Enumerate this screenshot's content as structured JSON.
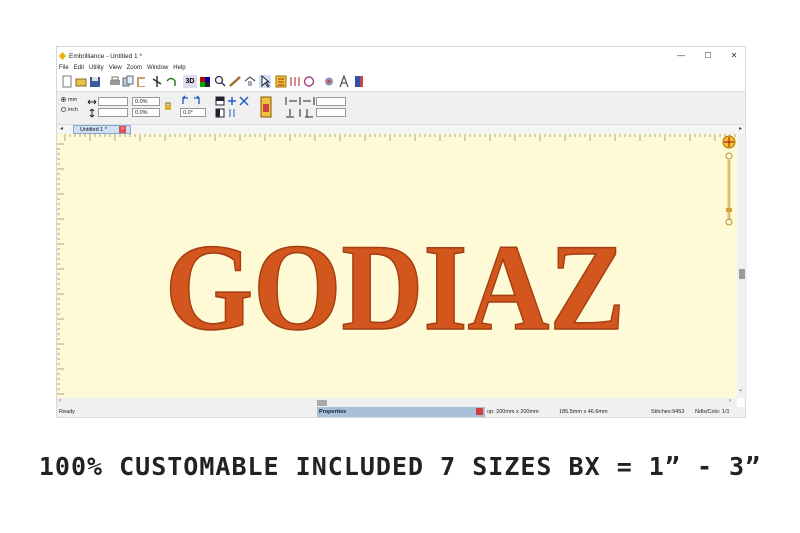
{
  "window": {
    "title": "Embrilliance - Untitled 1 *",
    "controls": {
      "minimize": "—",
      "maximize": "☐",
      "close": "✕"
    }
  },
  "menu": [
    "File",
    "Edit",
    "Utility",
    "View",
    "Zoom",
    "Window",
    "Help"
  ],
  "toolbar": {
    "icons": [
      "new-icon",
      "open-icon",
      "save-icon",
      "print-icon",
      "copy-icon",
      "paste-icon",
      "cut-icon",
      "undo-icon",
      "3d-icon",
      "color-icon",
      "zoom-icon",
      "measure-icon",
      "hoop-icon",
      "select-icon",
      "sort-icon",
      "stitch-icon",
      "thread-icon",
      "letter-a-icon",
      "book-icon"
    ],
    "three_d_label": "3D"
  },
  "properties_bar": {
    "unit_mm": "mm",
    "unit_inch": "inch",
    "width_value": "",
    "width_percent": "0.0%",
    "height_value": "",
    "height_percent": "0.0%",
    "rotation": "0.0°"
  },
  "tabs": [
    {
      "label": "Untitled 1 *"
    }
  ],
  "canvas": {
    "design_text": "GODIAZ",
    "design_color": "#d2561d",
    "background_color": "#fdfad5"
  },
  "status": {
    "ready": "Ready",
    "properties_label": "Properties",
    "hoop": "op: 200mm x 200mm",
    "size": "185.5mm x 46.6mm",
    "stitches": "Stitches:9453",
    "ndls": "Ndls/Colo: 1/1"
  },
  "caption": "100% CUSTOMABLE INCLUDED 7 SIZES BX = 1” -  3”"
}
